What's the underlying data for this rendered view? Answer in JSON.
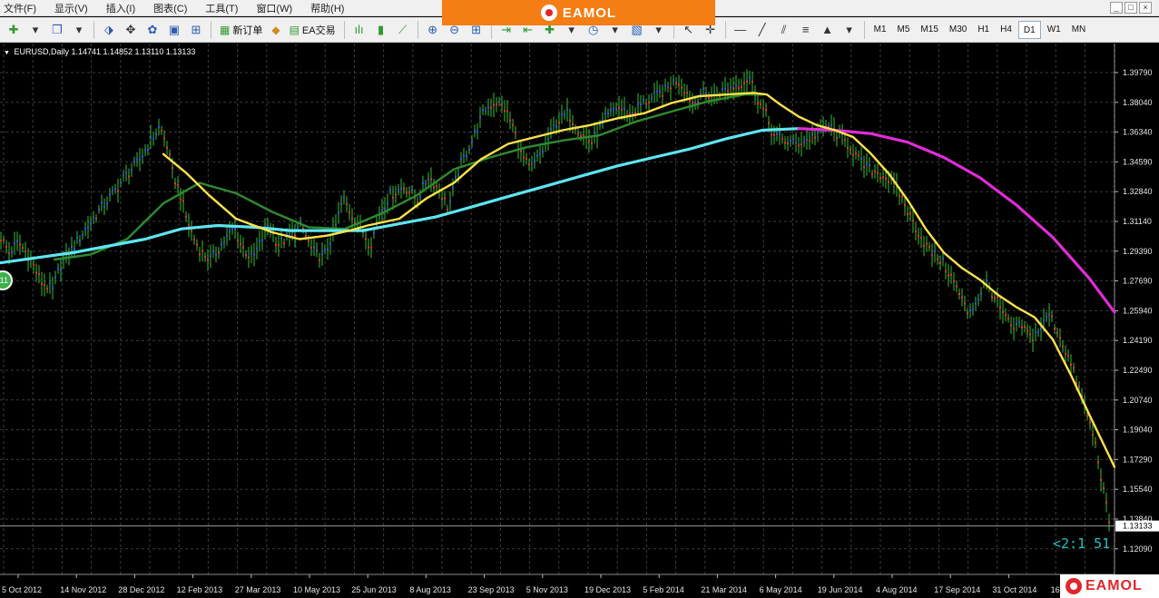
{
  "menu": {
    "items": [
      "文件(F)",
      "显示(V)",
      "插入(I)",
      "图表(C)",
      "工具(T)",
      "窗口(W)",
      "帮助(H)"
    ],
    "window_controls": [
      "_",
      "□",
      "×"
    ]
  },
  "brand": {
    "text": "EAMOL"
  },
  "toolbar": {
    "new_order_label": "新订单",
    "ea_trade_label": "EA交易",
    "timeframes": [
      "M1",
      "M5",
      "M15",
      "M30",
      "H1",
      "H4",
      "D1",
      "W1",
      "MN"
    ],
    "active_timeframe": "D1"
  },
  "chart": {
    "symbol_info": "EURUSD,Daily  1.14741 1.14852 1.13110 1.13133",
    "timer": "<2:1 51",
    "side_button": "11",
    "current_price": "1.13133",
    "colors": {
      "background": "#000000",
      "grid": "#3c3c3c",
      "bar_green": "#2aa02a",
      "bar_red": "#d2282a",
      "dots_up": "#3a4cff",
      "dots_down": "#ff2a2a",
      "ma_short": "#ffe24a",
      "ma_mid": "#2e8b2e",
      "ma_long_rising": "#5ee6f2",
      "ma_long_falling": "#e02cd6"
    }
  },
  "chart_data": {
    "type": "line",
    "title": "EURUSD,Daily",
    "yticks": [
      "1.39790",
      "1.38040",
      "1.36340",
      "1.34590",
      "1.32840",
      "1.31140",
      "1.29390",
      "1.27690",
      "1.25940",
      "1.24190",
      "1.22490",
      "1.20740",
      "1.19040",
      "1.17290",
      "1.15540",
      "1.13840",
      "1.12090"
    ],
    "xticks": [
      "5 Oct 2012",
      "14 Nov 2012",
      "28 Dec 2012",
      "12 Feb 2013",
      "27 Mar 2013",
      "10 May 2013",
      "25 Jun 2013",
      "8 Aug 2013",
      "23 Sep 2013",
      "5 Nov 2013",
      "19 Dec 2013",
      "5 Feb 2014",
      "21 Mar 2014",
      "6 May 2014",
      "19 Jun 2014",
      "4 Aug 2014",
      "17 Sep 2014",
      "31 Oct 2014",
      "16"
    ],
    "ylim": [
      1.109,
      1.405
    ],
    "grid": true,
    "series": [
      {
        "role": "price",
        "x": [
          0,
          10,
          20,
          32,
          45,
          58,
          66,
          78,
          92,
          108,
          122,
          138,
          152,
          164,
          176,
          184,
          190,
          198,
          205,
          214,
          222,
          232,
          246,
          258,
          266,
          278,
          288,
          296,
          306,
          318,
          332,
          344,
          356,
          368,
          378,
          388,
          398,
          408,
          418,
          430,
          446,
          460,
          472,
          484,
          494,
          506,
          520,
          534,
          546,
          556,
          566,
          574,
          584,
          598,
          612,
          626,
          640,
          652,
          666,
          680,
          694,
          708,
          720,
          734,
          746,
          756,
          764,
          772,
          786,
          800,
          814,
          826,
          836,
          844,
          852,
          864,
          876,
          888,
          900,
          912,
          924,
          936,
          948,
          958,
          968,
          980,
          992,
          1004,
          1016,
          1026,
          1036,
          1046,
          1056,
          1066,
          1076,
          1086,
          1096,
          1106,
          1116,
          1126,
          1136,
          1146,
          1156,
          1166,
          1176,
          1186,
          1196,
          1206,
          1214,
          1222
        ],
        "values": [
          1.302,
          1.292,
          1.298,
          1.29,
          1.275,
          1.27,
          1.284,
          1.293,
          1.304,
          1.316,
          1.325,
          1.337,
          1.345,
          1.356,
          1.366,
          1.355,
          1.339,
          1.328,
          1.313,
          1.3,
          1.292,
          1.288,
          1.298,
          1.307,
          1.296,
          1.288,
          1.299,
          1.309,
          1.297,
          1.301,
          1.308,
          1.293,
          1.289,
          1.304,
          1.324,
          1.314,
          1.307,
          1.296,
          1.315,
          1.326,
          1.331,
          1.323,
          1.337,
          1.329,
          1.318,
          1.342,
          1.358,
          1.376,
          1.381,
          1.377,
          1.365,
          1.35,
          1.341,
          1.352,
          1.368,
          1.374,
          1.362,
          1.357,
          1.37,
          1.378,
          1.373,
          1.38,
          1.383,
          1.388,
          1.394,
          1.387,
          1.379,
          1.386,
          1.384,
          1.388,
          1.391,
          1.395,
          1.381,
          1.373,
          1.361,
          1.358,
          1.356,
          1.358,
          1.362,
          1.367,
          1.361,
          1.355,
          1.345,
          1.341,
          1.339,
          1.335,
          1.326,
          1.312,
          1.3,
          1.292,
          1.288,
          1.28,
          1.269,
          1.257,
          1.263,
          1.275,
          1.266,
          1.255,
          1.247,
          1.249,
          1.242,
          1.247,
          1.256,
          1.245,
          1.232,
          1.217,
          1.2,
          1.182,
          1.158,
          1.133
        ]
      },
      {
        "name": "",
        "role": "ma_short",
        "x": [
          180,
          205,
          230,
          260,
          300,
          330,
          360,
          385,
          405,
          440,
          470,
          500,
          530,
          560,
          590,
          620,
          650,
          680,
          710,
          740,
          770,
          800,
          830,
          845,
          860,
          880,
          900,
          920,
          940,
          960,
          980,
          1000,
          1020,
          1040,
          1060,
          1080,
          1100,
          1120,
          1140,
          1160,
          1180,
          1200,
          1228
        ],
        "values": [
          1.35,
          1.339,
          1.326,
          1.312,
          1.304,
          1.3,
          1.302,
          1.305,
          1.308,
          1.312,
          1.324,
          1.333,
          1.347,
          1.356,
          1.36,
          1.364,
          1.367,
          1.371,
          1.374,
          1.38,
          1.384,
          1.385,
          1.386,
          1.385,
          1.379,
          1.372,
          1.367,
          1.364,
          1.36,
          1.35,
          1.338,
          1.323,
          1.306,
          1.292,
          1.283,
          1.276,
          1.267,
          1.26,
          1.254,
          1.241,
          1.22,
          1.197,
          1.166
        ]
      },
      {
        "name": "",
        "role": "ma_mid",
        "x": [
          60,
          100,
          140,
          180,
          220,
          260,
          300,
          340,
          380,
          420,
          460,
          500,
          540,
          580,
          620,
          660,
          700,
          740,
          780,
          820,
          840
        ],
        "values": [
          1.288,
          1.291,
          1.3,
          1.321,
          1.333,
          1.327,
          1.316,
          1.307,
          1.306,
          1.315,
          1.326,
          1.341,
          1.348,
          1.354,
          1.358,
          1.361,
          1.369,
          1.375,
          1.381,
          1.385,
          1.385
        ]
      },
      {
        "name": "",
        "role": "ma_long",
        "x": [
          0,
          40,
          80,
          120,
          160,
          200,
          240,
          280,
          320,
          360,
          400,
          440,
          480,
          520,
          560,
          600,
          640,
          680,
          720,
          760,
          800,
          840,
          880,
          920,
          960,
          1000,
          1040,
          1080,
          1120,
          1160,
          1200,
          1228
        ],
        "values": [
          1.286,
          1.289,
          1.292,
          1.296,
          1.3,
          1.306,
          1.308,
          1.307,
          1.305,
          1.305,
          1.305,
          1.309,
          1.313,
          1.319,
          1.325,
          1.331,
          1.337,
          1.343,
          1.348,
          1.353,
          1.359,
          1.364,
          1.365,
          1.364,
          1.362,
          1.357,
          1.348,
          1.336,
          1.32,
          1.301,
          1.277,
          1.257
        ]
      }
    ]
  }
}
